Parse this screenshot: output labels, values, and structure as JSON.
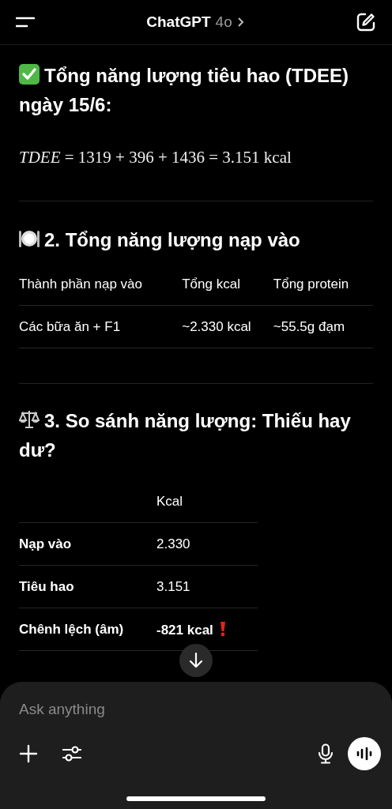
{
  "header": {
    "title": "ChatGPT",
    "model": "4o"
  },
  "tdee_section": {
    "heading": "Tổng năng lượng tiêu hao (TDEE) ngày 15/6:",
    "formula": "*TDEE* = 1319 + 396 + 1436 =  3.151 kcal"
  },
  "intake_section": {
    "heading": "2. Tổng năng lượng nạp vào",
    "table": {
      "columns": [
        "Thành phần nạp vào",
        "Tổng kcal",
        "Tổng protein"
      ],
      "rows": [
        [
          "Các bữa ăn + F1",
          "~2.330 kcal",
          "~55.5g đạm"
        ]
      ]
    }
  },
  "compare_section": {
    "heading": "3. So sánh năng lượng: Thiếu hay dư?",
    "table": {
      "columns": [
        "Kcal"
      ],
      "rows": [
        {
          "label": "Nạp vào",
          "value": "2.330",
          "emphasized": false,
          "warning": false
        },
        {
          "label": "Tiêu hao",
          "value": "3.151",
          "emphasized": false,
          "warning": false
        },
        {
          "label": "Chênh lệch (âm)",
          "value": "-821 kcal",
          "emphasized": true,
          "warning": true
        }
      ]
    }
  },
  "composer": {
    "placeholder": "Ask anything"
  }
}
